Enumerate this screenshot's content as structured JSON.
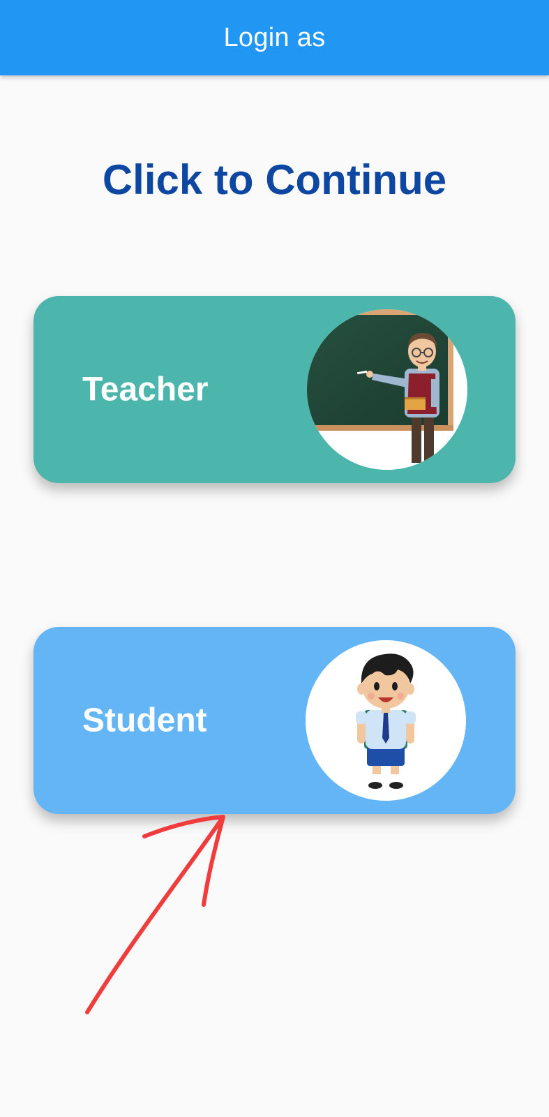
{
  "app_bar": {
    "title": "Login as"
  },
  "page": {
    "heading": "Click to Continue"
  },
  "roles": [
    {
      "label": "Teacher",
      "card_color": "#4db6ac",
      "illustration": "teacher-at-chalkboard-illustration"
    },
    {
      "label": "Student",
      "card_color": "#64b5f6",
      "illustration": "schoolboy-with-backpack-illustration"
    }
  ],
  "annotation": {
    "type": "hand-drawn-arrow",
    "color": "#f03c3c",
    "points_to": "student-card"
  },
  "colors": {
    "app_bar": "#2196f3",
    "heading": "#0d47a1",
    "background": "#fafafa"
  }
}
